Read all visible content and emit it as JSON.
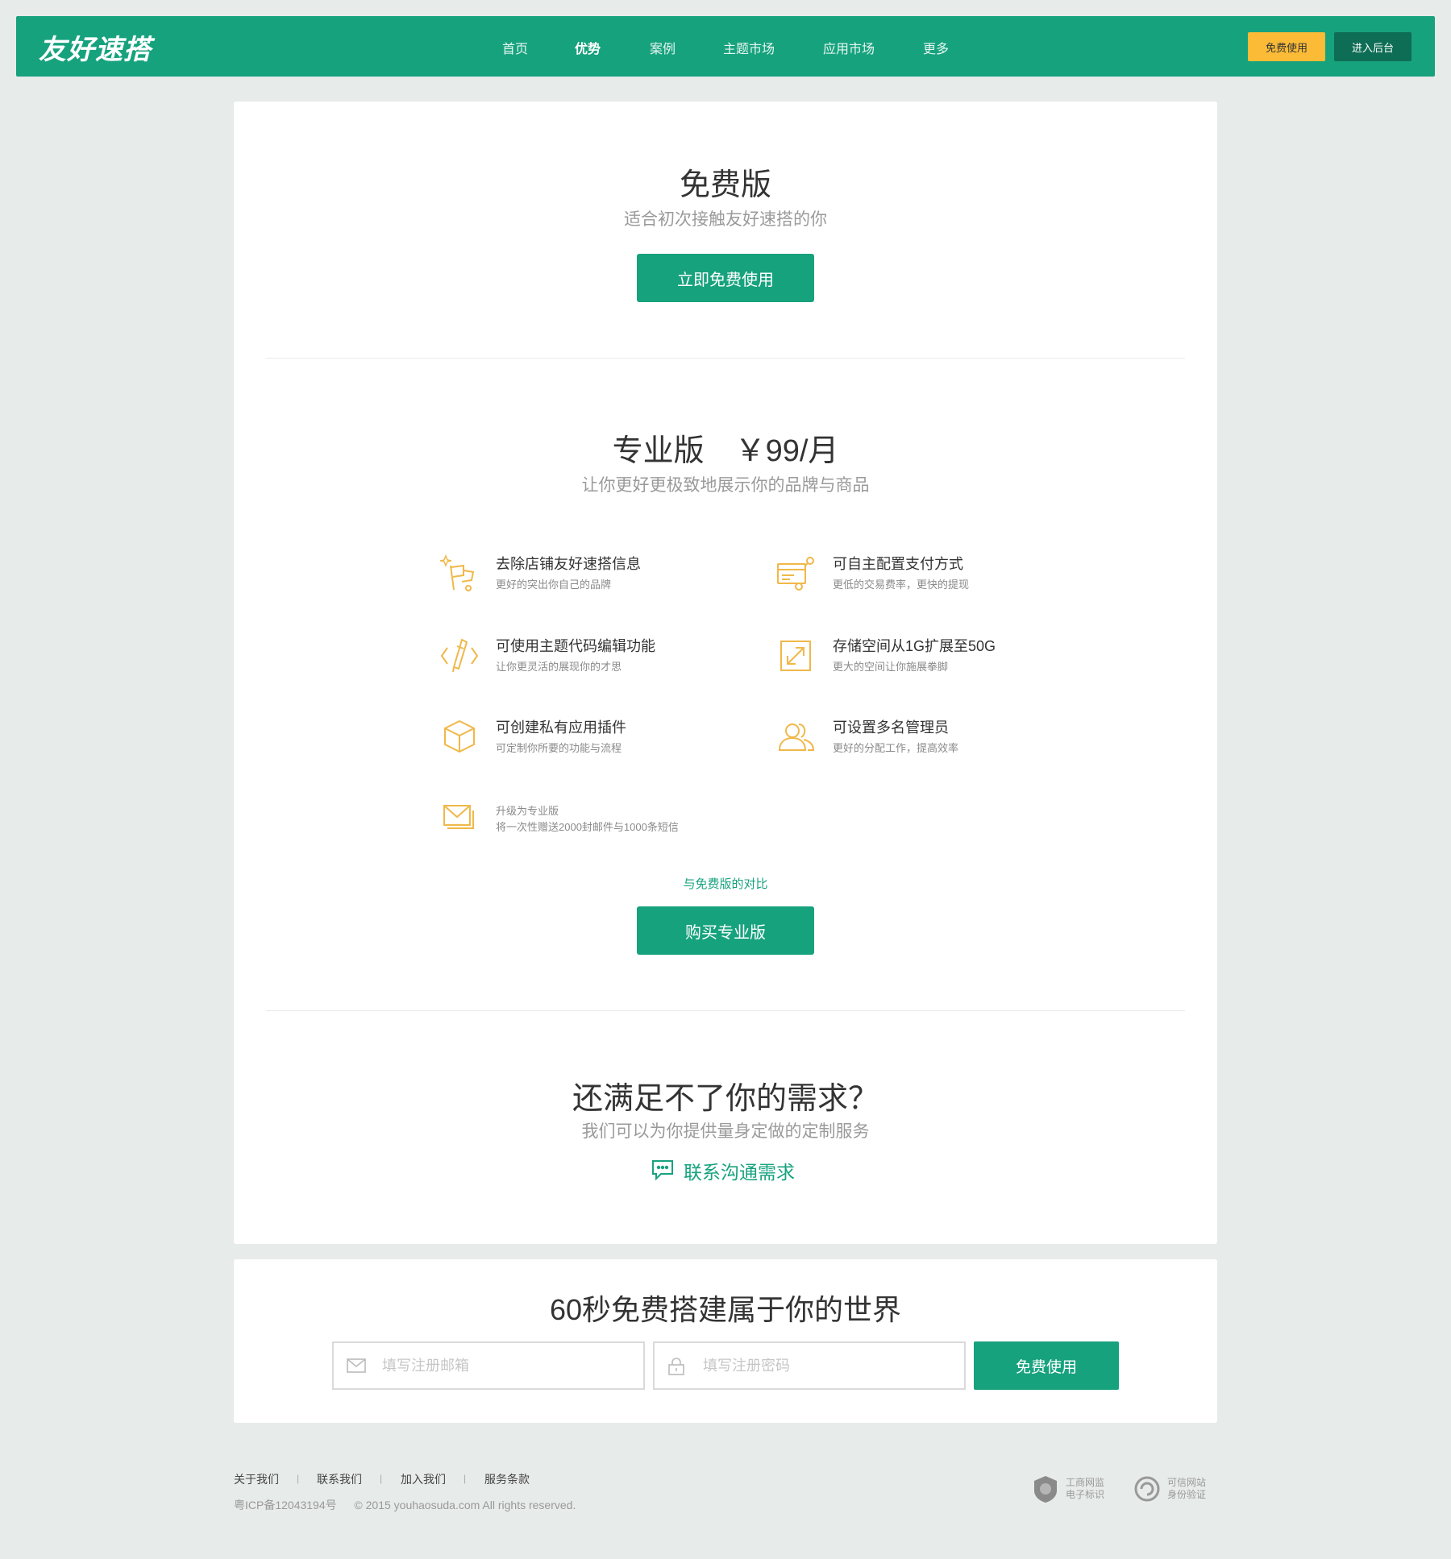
{
  "header": {
    "logo": "友好速搭",
    "nav": [
      "首页",
      "优势",
      "案例",
      "主题市场",
      "应用市场",
      "更多"
    ],
    "active_nav": "优势",
    "free_button": "免费使用",
    "admin_button": "进入后台"
  },
  "free_plan": {
    "title": "免费版",
    "subtitle": "适合初次接触友好速搭的你",
    "button": "立即免费使用"
  },
  "pro_plan": {
    "title": "专业版　￥99/月",
    "subtitle": "让你更好更极致地展示你的品牌与商品",
    "features": [
      {
        "icon": "flag-icon",
        "title": "去除店铺友好速搭信息",
        "desc": "更好的突出你自己的品牌"
      },
      {
        "icon": "credit-card-icon",
        "title": "可自主配置支付方式",
        "desc": "更低的交易费率，更快的提现"
      },
      {
        "icon": "code-edit-icon",
        "title": "可使用主题代码编辑功能",
        "desc": "让你更灵活的展现你的才思"
      },
      {
        "icon": "expand-icon",
        "title": "存储空间从1G扩展至50G",
        "desc": "更大的空间让你施展拳脚"
      },
      {
        "icon": "cube-icon",
        "title": "可创建私有应用插件",
        "desc": "可定制你所要的功能与流程"
      },
      {
        "icon": "users-icon",
        "title": "可设置多名管理员",
        "desc": "更好的分配工作，提高效率"
      },
      {
        "icon": "mail-icon",
        "title": "升级为专业版",
        "desc": "将一次性赠送2000封邮件与1000条短信"
      }
    ],
    "compare_link": "与免费版的对比",
    "buy_button": "购买专业版"
  },
  "custom": {
    "title": "还满足不了你的需求？",
    "subtitle": "我们可以为你提供量身定做的定制服务",
    "contact_link": "联系沟通需求"
  },
  "register": {
    "title": "60秒免费搭建属于你的世界",
    "email_placeholder": "填写注册邮箱",
    "password_placeholder": "填写注册密码",
    "submit": "免费使用"
  },
  "footer": {
    "links": [
      "关于我们",
      "联系我们",
      "加入我们",
      "服务条款"
    ],
    "separator": "|",
    "icp": "粤ICP备12043194号",
    "copyright": "© 2015 youhaosuda.com All rights reserved.",
    "badges": [
      {
        "line1": "工商网监",
        "line2": "电子标识"
      },
      {
        "line1": "可信网站",
        "line2": "身份验证"
      }
    ]
  },
  "colors": {
    "brand_green": "#17a27e",
    "accent_yellow": "#fbbb37",
    "dark_green": "#0e6d55",
    "icon_orange": "#f0b84a",
    "background": "#e7ebe9"
  }
}
